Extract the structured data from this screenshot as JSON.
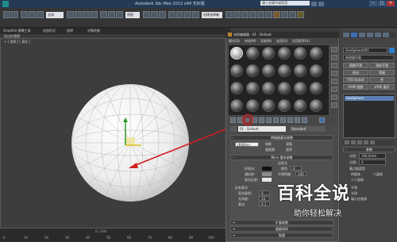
{
  "titlebar": {
    "title": "Autodesk 3ds Max 2012 x64   无标题",
    "search_placeholder": "键入关键字或短语",
    "minimize": "–",
    "maximize": "□",
    "close": "✕"
  },
  "toolbar": {
    "selection_filter": "全部",
    "view_dropdown": "视图",
    "named_set": "创建选择集"
  },
  "ribbon": {
    "tabs": [
      "Graphite 建模工具",
      "自由形式",
      "选择",
      "对象绘制"
    ]
  },
  "viewport": {
    "label": "+ [ 透视 ] [ 真实 ]",
    "header": "多边形建模"
  },
  "material_editor": {
    "title": "材质编辑器 - 01 - Default",
    "menu": [
      "模式(D)",
      "材质(M)",
      "导航(N)",
      "选项(O)",
      "实用程序(U)"
    ],
    "material_name": "01 - Default",
    "material_type": "Standard",
    "rollouts": {
      "shader_basic": "明暗器基本参数",
      "blinn_basic": "Blinn 基本参数",
      "extended": "扩展参数",
      "supersampling": "超级采样",
      "maps": "贴图"
    },
    "shader": {
      "type": "(B)Blinn",
      "wire": "线框",
      "two_sided": "双面",
      "face_map": "面贴图",
      "faceted": "面状"
    },
    "blinn": {
      "ambient": "环境光:",
      "diffuse": "漫反射:",
      "specular": "高光反射:",
      "self_illum": "自发光",
      "color": "颜色",
      "color_value": "0",
      "opacity": "不透明度:",
      "opacity_value": "100",
      "spec_highlights": "反射高光",
      "spec_level": "高光级别:",
      "spec_level_value": "0",
      "glossiness": "光泽度:",
      "glossiness_value": "10",
      "soften": "柔化:",
      "soften_value": "0.1"
    }
  },
  "command_panel": {
    "object_name": "GeoSphere001",
    "modifier_list": "修改器列表",
    "buttons": [
      "网格平滑",
      "挤出",
      "FFD 4x4x4",
      "UVW 贴图",
      "涡轮平滑",
      "弯曲",
      "壳",
      "UVW 展开"
    ],
    "stack_item": "GeoSphere",
    "params_title": "参数",
    "radius_label": "半径:",
    "radius_value": "100.0mm",
    "segments_label": "分段:",
    "segments_value": "4",
    "geo_types_label": "基点面类型",
    "types": [
      "四面体",
      "八面体",
      "二十面体"
    ],
    "smooth": "平滑",
    "hemisphere": "半球",
    "base_pivot": "轴心在底部"
  },
  "bottom": {
    "frame_counter": "0 / 100",
    "timeline": [
      "0",
      "10",
      "20",
      "30",
      "40",
      "50",
      "60",
      "70",
      "80",
      "90",
      "100"
    ]
  },
  "watermark": {
    "title": "百科全说",
    "subtitle": "助你轻松解决"
  },
  "colors": {
    "annotation_arrow": "#d21f1f",
    "sphere": "#f4f4f4",
    "selection_blue": "#5b7fb2"
  }
}
